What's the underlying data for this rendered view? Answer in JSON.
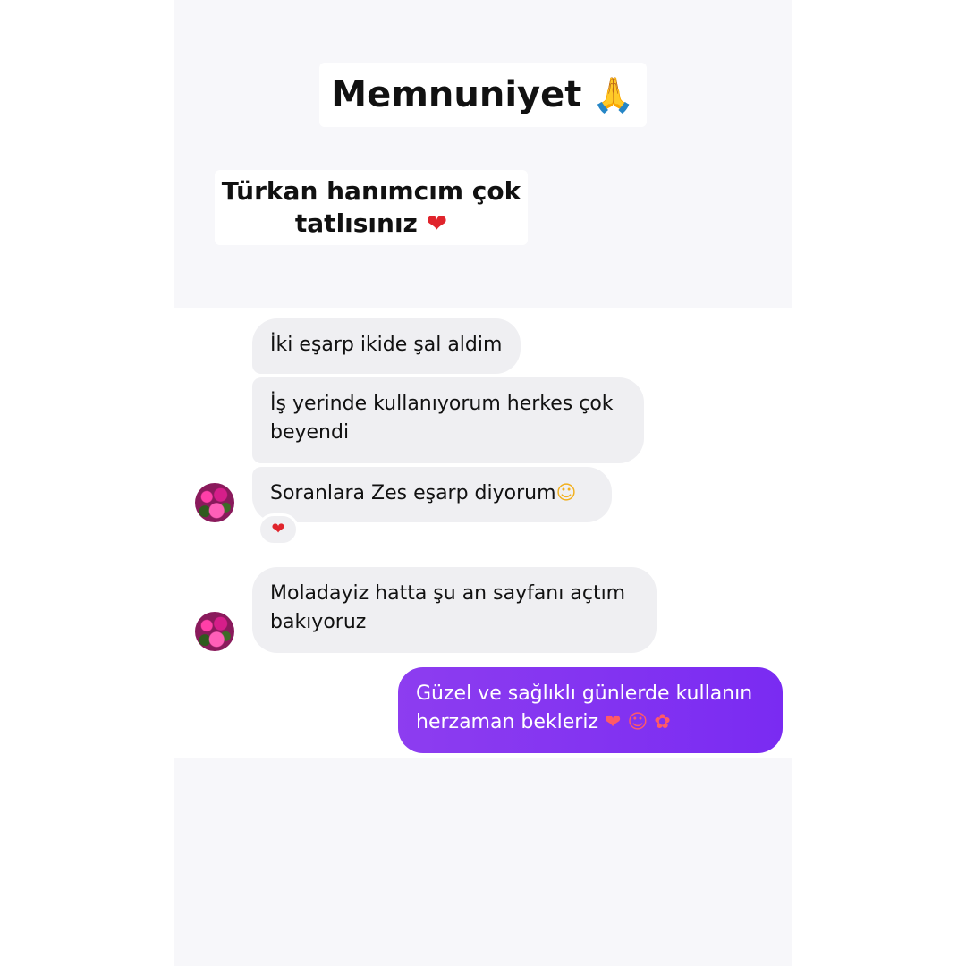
{
  "header": {
    "title": "Memnuniyet",
    "title_emoji": "🙏",
    "caption_line1": "Türkan hanımcım çok",
    "caption_line2": "tatlısınız",
    "caption_emoji": "❤"
  },
  "messages": [
    {
      "direction": "incoming",
      "text": "İki eşarp ikide şal aldim"
    },
    {
      "direction": "incoming",
      "text_line1": "İş yerinde kullanıyorum herkes çok",
      "text_line2": "beyendi"
    },
    {
      "direction": "incoming",
      "text": "Soranlara Zes eşarp diyorum",
      "emoji": "☺",
      "reaction": "❤"
    },
    {
      "direction": "incoming",
      "text_line1": "Moladayiz hatta şu an sayfanı açtım",
      "text_line2": "bakıyoruz"
    },
    {
      "direction": "outgoing",
      "text_line1": "Güzel ve sağlıklı günlerde kullanın",
      "text_line2": "herzaman bekleriz",
      "emojis": "❤ ☺ ✿"
    }
  ],
  "colors": {
    "incoming_bubble": "#efeff2",
    "outgoing_bubble": "#8d3df0",
    "heart": "#e0242c",
    "story_background": "#f7f7fa"
  }
}
